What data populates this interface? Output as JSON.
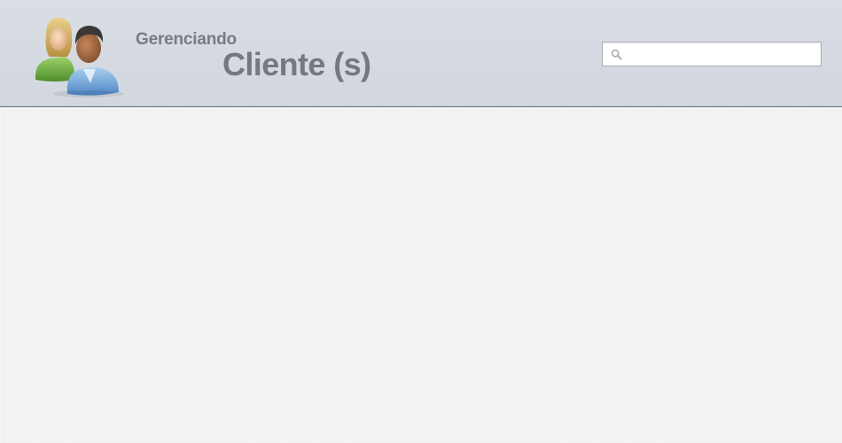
{
  "header": {
    "subtitle": "Gerenciando",
    "title": "Cliente (s)",
    "logo_icon": "users-icon"
  },
  "search": {
    "placeholder": "",
    "value": "",
    "icon": "search-icon"
  },
  "colors": {
    "header_background": "#d5d9e0",
    "title_text": "#75797f",
    "page_background": "#f3f3f3"
  }
}
